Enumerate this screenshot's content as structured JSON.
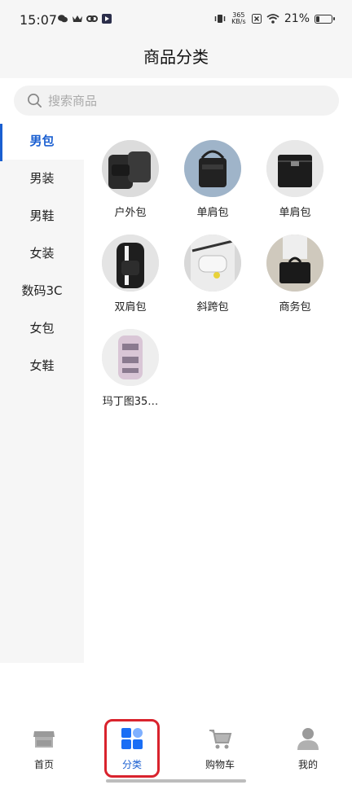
{
  "status_bar": {
    "time": "15:07",
    "speed": "365\nKB/s",
    "battery": "21%",
    "battery_level": 0.21,
    "icons": [
      "wechat-icon",
      "crown-icon",
      "link-icon",
      "app-icon",
      "vibrate-icon",
      "close-box-icon",
      "wifi-icon"
    ]
  },
  "header": {
    "title": "商品分类"
  },
  "search": {
    "placeholder": "搜索商品"
  },
  "sidebar": {
    "items": [
      {
        "label": "男包",
        "active": true
      },
      {
        "label": "男装",
        "active": false
      },
      {
        "label": "男鞋",
        "active": false
      },
      {
        "label": "女装",
        "active": false
      },
      {
        "label": "数码3C",
        "active": false
      },
      {
        "label": "女包",
        "active": false
      },
      {
        "label": "女鞋",
        "active": false
      }
    ]
  },
  "products": [
    {
      "label": "户外包"
    },
    {
      "label": "单肩包"
    },
    {
      "label": "单肩包"
    },
    {
      "label": "双肩包"
    },
    {
      "label": "斜跨包"
    },
    {
      "label": "商务包"
    },
    {
      "label": "玛丁图35…"
    }
  ],
  "tabbar": {
    "tabs": [
      {
        "label": "首页",
        "icon": "store-icon"
      },
      {
        "label": "分类",
        "icon": "category-icon",
        "active": true
      },
      {
        "label": "购物车",
        "icon": "cart-icon"
      },
      {
        "label": "我的",
        "icon": "user-icon"
      }
    ]
  },
  "colors": {
    "accent": "#1a5fd1",
    "highlight": "#d9232d",
    "sidebar_bg": "#f6f6f6"
  }
}
